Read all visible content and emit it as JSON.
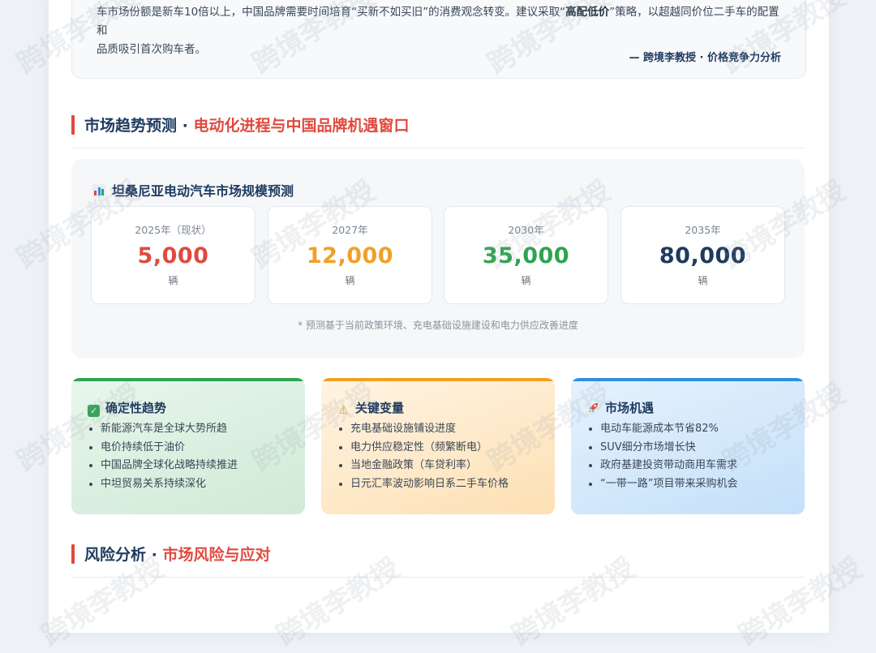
{
  "quote": {
    "line1_pre": "车市场份额是新车10倍以上，中国品牌需要时间培育“买新不如买旧”的消费观念转变。建议采取“",
    "line1_bold": "高配低价",
    "line1_post": "”策略，以超越同价位二手车的配置和",
    "line2": "品质吸引首次购车者。",
    "signature": "— 跨境李教授 · 价格竞争力分析"
  },
  "section_trend": {
    "title_main": "市场趋势预测 · ",
    "title_accent": "电动化进程与中国品牌机遇窗口"
  },
  "forecast": {
    "title": "坦桑尼亚电动汽车市场规模预测",
    "icon": "bar-chart-icon",
    "cards": [
      {
        "year": "2025年（现状）",
        "value": "5,000",
        "unit": "辆",
        "color": "#e04a3f"
      },
      {
        "year": "2027年",
        "value": "12,000",
        "unit": "辆",
        "color": "#f0a125"
      },
      {
        "year": "2030年",
        "value": "35,000",
        "unit": "辆",
        "color": "#2ea44f"
      },
      {
        "year": "2035年",
        "value": "80,000",
        "unit": "辆",
        "color": "#1e3a5f"
      }
    ],
    "note": "* 预测基于当前政策环境、充电基础设施建设和电力供应改善进度"
  },
  "cards": [
    {
      "title": "确定性趋势",
      "icon": "check-icon",
      "items": [
        "新能源汽车是全球大势所趋",
        "电价持续低于油价",
        "中国品牌全球化战略持续推进",
        "中坦贸易关系持续深化"
      ]
    },
    {
      "title": "关键变量",
      "icon": "warning-icon",
      "items": [
        "充电基础设施铺设进度",
        "电力供应稳定性（频繁断电）",
        "当地金融政策（车贷利率）",
        "日元汇率波动影响日系二手车价格"
      ]
    },
    {
      "title": "市场机遇",
      "icon": "rocket-icon",
      "items": [
        "电动车能源成本节省82%",
        "SUV细分市场增长快",
        "政府基建投资带动商用车需求",
        "“一带一路”项目带来采购机会"
      ]
    }
  ],
  "section_risk": {
    "title_main": "风险分析 · ",
    "title_accent": "市场风险与应对"
  },
  "watermark": "跨境李教授",
  "colors": {
    "accent_red": "#e04a3f",
    "navy": "#1e3a5f",
    "green": "#2ea44f",
    "orange": "#f0a125",
    "blue": "#2d8fe6"
  }
}
